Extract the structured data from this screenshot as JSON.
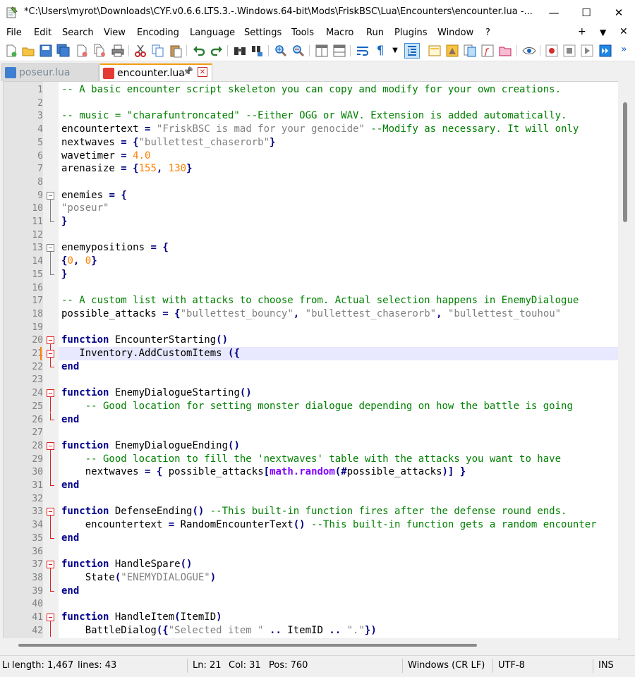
{
  "window": {
    "title": "*C:\\Users\\myrot\\Downloads\\CYF.v0.6.6.LTS.3.-.Windows.64-bit\\Mods\\FriskBSC\\Lua\\Encounters\\encounter.lua -...",
    "minimize": "—",
    "maximize": "☐",
    "close": "✕"
  },
  "menu": {
    "items": [
      "File",
      "Edit",
      "Search",
      "View",
      "Encoding",
      "Language",
      "Settings",
      "Tools",
      "Macro",
      "Run",
      "Plugins",
      "Window",
      "?"
    ],
    "right": {
      "plus": "+",
      "dropdown": "▼",
      "close": "✕"
    }
  },
  "toolbar": {
    "buttons": [
      "new-file",
      "open-file",
      "save",
      "save-all",
      "close",
      "close-all",
      "print",
      "cut",
      "copy",
      "paste",
      "undo",
      "redo",
      "find",
      "replace",
      "zoom-in",
      "zoom-out",
      "sync-vertical",
      "sync-horizontal",
      "word-wrap",
      "show-all-chars",
      "indent-guide",
      "doc-map",
      "function-list",
      "folder-workspace",
      "monitoring",
      "record-macro",
      "stop-macro",
      "play-macro",
      "run-macro-multiple"
    ],
    "overflow": "»"
  },
  "tabs": [
    {
      "label": "poseur.lua",
      "active": false,
      "pin": "",
      "close": ""
    },
    {
      "label": "encounter.lua",
      "active": true,
      "pin": "📌",
      "close": "✕"
    }
  ],
  "colors": {
    "comment": "#008000",
    "string": "#808080",
    "number": "#ff8000",
    "keyword": "#00008b",
    "library": "#8000ff",
    "fold": "#e02020",
    "caret_line": "#e8e8ff"
  },
  "editor": {
    "current_line": 21,
    "lines": [
      {
        "n": "1",
        "tokens": [
          [
            "comment",
            "-- A basic encounter script skeleton you can copy and modify for your own creations."
          ]
        ]
      },
      {
        "n": "2",
        "tokens": []
      },
      {
        "n": "3",
        "tokens": [
          [
            "comment",
            "-- music = \"charafuntroncated\" --Either OGG or WAV. Extension is added automatically."
          ]
        ]
      },
      {
        "n": "4",
        "tokens": [
          [
            "plain",
            "encountertext "
          ],
          [
            "op",
            "="
          ],
          [
            "plain",
            " "
          ],
          [
            "string",
            "\"FriskBSC is mad for your genocide\""
          ],
          [
            "plain",
            " "
          ],
          [
            "comment",
            "--Modify as necessary. It will only"
          ]
        ]
      },
      {
        "n": "5",
        "tokens": [
          [
            "plain",
            "nextwaves "
          ],
          [
            "op",
            "="
          ],
          [
            "plain",
            " "
          ],
          [
            "op",
            "{"
          ],
          [
            "string",
            "\"bullettest_chaserorb\""
          ],
          [
            "op",
            "}"
          ]
        ]
      },
      {
        "n": "6",
        "tokens": [
          [
            "plain",
            "wavetimer "
          ],
          [
            "op",
            "="
          ],
          [
            "plain",
            " "
          ],
          [
            "number",
            "4.0"
          ]
        ]
      },
      {
        "n": "7",
        "tokens": [
          [
            "plain",
            "arenasize "
          ],
          [
            "op",
            "="
          ],
          [
            "plain",
            " "
          ],
          [
            "op",
            "{"
          ],
          [
            "number",
            "155"
          ],
          [
            "op",
            ","
          ],
          [
            "plain",
            " "
          ],
          [
            "number",
            "130"
          ],
          [
            "op",
            "}"
          ]
        ]
      },
      {
        "n": "8",
        "tokens": []
      },
      {
        "n": "9",
        "tokens": [
          [
            "plain",
            "enemies "
          ],
          [
            "op",
            "="
          ],
          [
            "plain",
            " "
          ],
          [
            "op",
            "{"
          ]
        ],
        "fold": "start"
      },
      {
        "n": "10",
        "tokens": [
          [
            "string",
            "\"poseur\""
          ]
        ],
        "fold": "mid"
      },
      {
        "n": "11",
        "tokens": [
          [
            "op",
            "}"
          ]
        ],
        "fold": "end"
      },
      {
        "n": "12",
        "tokens": []
      },
      {
        "n": "13",
        "tokens": [
          [
            "plain",
            "enemypositions "
          ],
          [
            "op",
            "="
          ],
          [
            "plain",
            " "
          ],
          [
            "op",
            "{"
          ]
        ],
        "fold": "start"
      },
      {
        "n": "14",
        "tokens": [
          [
            "op",
            "{"
          ],
          [
            "number",
            "0"
          ],
          [
            "op",
            ","
          ],
          [
            "plain",
            " "
          ],
          [
            "number",
            "0"
          ],
          [
            "op",
            "}"
          ]
        ],
        "fold": "mid"
      },
      {
        "n": "15",
        "tokens": [
          [
            "op",
            "}"
          ]
        ],
        "fold": "end"
      },
      {
        "n": "16",
        "tokens": []
      },
      {
        "n": "17",
        "tokens": [
          [
            "comment",
            "-- A custom list with attacks to choose from. Actual selection happens in EnemyDialogue"
          ]
        ]
      },
      {
        "n": "18",
        "tokens": [
          [
            "plain",
            "possible_attacks "
          ],
          [
            "op",
            "="
          ],
          [
            "plain",
            " "
          ],
          [
            "op",
            "{"
          ],
          [
            "string",
            "\"bullettest_bouncy\""
          ],
          [
            "op",
            ","
          ],
          [
            "plain",
            " "
          ],
          [
            "string",
            "\"bullettest_chaserorb\""
          ],
          [
            "op",
            ","
          ],
          [
            "plain",
            " "
          ],
          [
            "string",
            "\"bullettest_touhou\""
          ]
        ]
      },
      {
        "n": "19",
        "tokens": []
      },
      {
        "n": "20",
        "tokens": [
          [
            "keyword",
            "function"
          ],
          [
            "plain",
            " EncounterStarting"
          ],
          [
            "op",
            "()"
          ]
        ],
        "fold": "start"
      },
      {
        "n": "21",
        "tokens": [
          [
            "plain",
            "   Inventory.AddCustomItems "
          ],
          [
            "op",
            "({"
          ]
        ],
        "fold": "start-red"
      },
      {
        "n": "22",
        "tokens": [
          [
            "keyword",
            "end"
          ]
        ],
        "fold": "end"
      },
      {
        "n": "23",
        "tokens": []
      },
      {
        "n": "24",
        "tokens": [
          [
            "keyword",
            "function"
          ],
          [
            "plain",
            " EnemyDialogueStarting"
          ],
          [
            "op",
            "()"
          ]
        ],
        "fold": "start"
      },
      {
        "n": "25",
        "tokens": [
          [
            "plain",
            "    "
          ],
          [
            "comment",
            "-- Good location for setting monster dialogue depending on how the battle is going"
          ]
        ],
        "fold": "mid"
      },
      {
        "n": "26",
        "tokens": [
          [
            "keyword",
            "end"
          ]
        ],
        "fold": "end"
      },
      {
        "n": "27",
        "tokens": []
      },
      {
        "n": "28",
        "tokens": [
          [
            "keyword",
            "function"
          ],
          [
            "plain",
            " EnemyDialogueEnding"
          ],
          [
            "op",
            "()"
          ]
        ],
        "fold": "start"
      },
      {
        "n": "29",
        "tokens": [
          [
            "plain",
            "    "
          ],
          [
            "comment",
            "-- Good location to fill the 'nextwaves' table with the attacks you want to have"
          ]
        ],
        "fold": "mid"
      },
      {
        "n": "30",
        "tokens": [
          [
            "plain",
            "    nextwaves "
          ],
          [
            "op",
            "="
          ],
          [
            "plain",
            " "
          ],
          [
            "op",
            "{"
          ],
          [
            "plain",
            " possible_attacks"
          ],
          [
            "op",
            "["
          ],
          [
            "lib",
            "math.random"
          ],
          [
            "op",
            "(#"
          ],
          [
            "plain",
            "possible_attacks"
          ],
          [
            "op",
            ")]"
          ],
          [
            "plain",
            " "
          ],
          [
            "op",
            "}"
          ]
        ],
        "fold": "mid"
      },
      {
        "n": "31",
        "tokens": [
          [
            "keyword",
            "end"
          ]
        ],
        "fold": "end"
      },
      {
        "n": "32",
        "tokens": []
      },
      {
        "n": "33",
        "tokens": [
          [
            "keyword",
            "function"
          ],
          [
            "plain",
            " DefenseEnding"
          ],
          [
            "op",
            "()"
          ],
          [
            "plain",
            " "
          ],
          [
            "comment",
            "--This built-in function fires after the defense round ends."
          ]
        ],
        "fold": "start"
      },
      {
        "n": "34",
        "tokens": [
          [
            "plain",
            "    encountertext "
          ],
          [
            "op",
            "="
          ],
          [
            "plain",
            " RandomEncounterText"
          ],
          [
            "op",
            "()"
          ],
          [
            "plain",
            " "
          ],
          [
            "comment",
            "--This built-in function gets a random encounter"
          ]
        ],
        "fold": "mid"
      },
      {
        "n": "35",
        "tokens": [
          [
            "keyword",
            "end"
          ]
        ],
        "fold": "end"
      },
      {
        "n": "36",
        "tokens": []
      },
      {
        "n": "37",
        "tokens": [
          [
            "keyword",
            "function"
          ],
          [
            "plain",
            " HandleSpare"
          ],
          [
            "op",
            "()"
          ]
        ],
        "fold": "start"
      },
      {
        "n": "38",
        "tokens": [
          [
            "plain",
            "    State"
          ],
          [
            "op",
            "("
          ],
          [
            "string",
            "\"ENEMYDIALOGUE\""
          ],
          [
            "op",
            ")"
          ]
        ],
        "fold": "mid"
      },
      {
        "n": "39",
        "tokens": [
          [
            "keyword",
            "end"
          ]
        ],
        "fold": "end"
      },
      {
        "n": "40",
        "tokens": []
      },
      {
        "n": "41",
        "tokens": [
          [
            "keyword",
            "function"
          ],
          [
            "plain",
            " HandleItem"
          ],
          [
            "op",
            "("
          ],
          [
            "plain",
            "ItemID"
          ],
          [
            "op",
            ")"
          ]
        ],
        "fold": "start"
      },
      {
        "n": "42",
        "tokens": [
          [
            "plain",
            "    BattleDialog"
          ],
          [
            "op",
            "({"
          ],
          [
            "string",
            "\"Selected item \""
          ],
          [
            "plain",
            " "
          ],
          [
            "op",
            ".."
          ],
          [
            "plain",
            " ItemID "
          ],
          [
            "op",
            ".."
          ],
          [
            "plain",
            " "
          ],
          [
            "string",
            "\".\""
          ],
          [
            "op",
            "})"
          ]
        ],
        "fold": "mid"
      }
    ]
  },
  "status": {
    "doc_type": "Lı",
    "length": "length: 1,467",
    "lines": "lines: 43",
    "ln": "Ln: 21",
    "col": "Col: 31",
    "pos": "Pos: 760",
    "eol": "Windows (CR LF)",
    "encoding": "UTF-8",
    "mode": "INS"
  }
}
